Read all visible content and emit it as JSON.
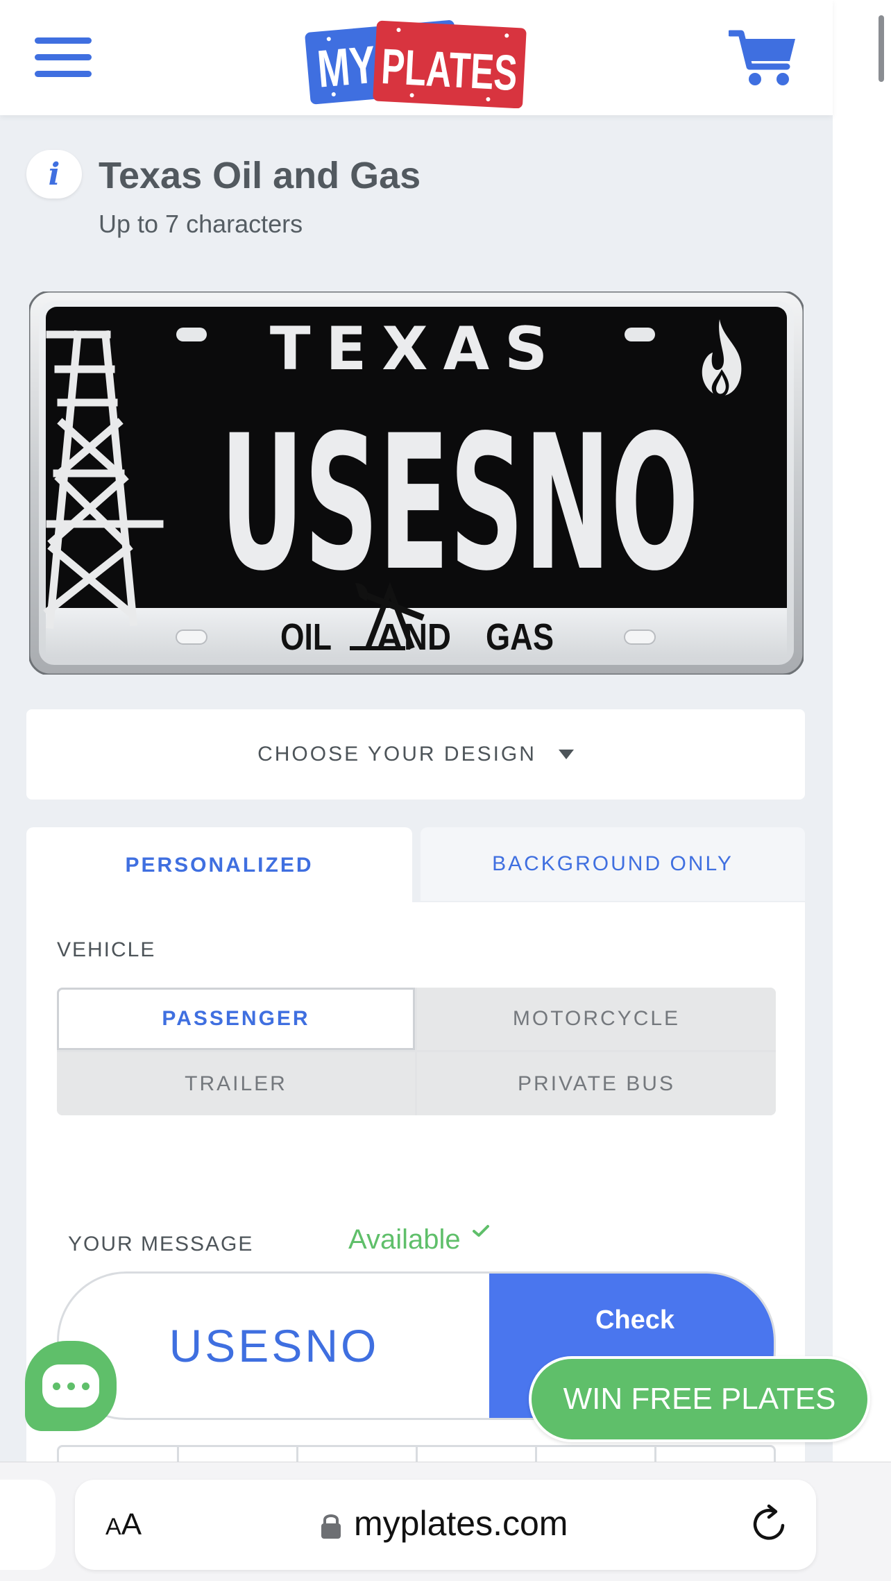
{
  "header": {
    "logo_left": "MY",
    "logo_right": "PLATES"
  },
  "plate_info": {
    "info_glyph": "i",
    "title": "Texas Oil and Gas",
    "subtitle": "Up to 7 characters"
  },
  "plate": {
    "state": "TEXAS",
    "text": "USESNO",
    "bottom_left": "OIL",
    "bottom_a": "A",
    "bottom_nd": "ND",
    "bottom_gas": "GAS"
  },
  "design": {
    "label": "CHOOSE YOUR DESIGN"
  },
  "tabs": [
    {
      "label": "PERSONALIZED",
      "selected": true
    },
    {
      "label": "BACKGROUND ONLY",
      "selected": false
    }
  ],
  "vehicle": {
    "label": "VEHICLE",
    "options": [
      {
        "label": "PASSENGER",
        "selected": true
      },
      {
        "label": "MOTORCYCLE",
        "selected": false
      },
      {
        "label": "TRAILER",
        "selected": false
      },
      {
        "label": "PRIVATE BUS",
        "selected": false
      }
    ]
  },
  "message": {
    "label": "YOUR MESSAGE",
    "status": "Available",
    "value": "USESNO",
    "check_label": "Check"
  },
  "promo": {
    "label": "WIN FREE PLATES"
  },
  "browser": {
    "text_size_small": "A",
    "text_size_large": "A",
    "url": "myplates.com"
  },
  "colors": {
    "brand_blue": "#3f6fe0",
    "brand_red": "#d8343f",
    "available_green": "#5fbf6a",
    "check_button": "#4a76ee"
  }
}
